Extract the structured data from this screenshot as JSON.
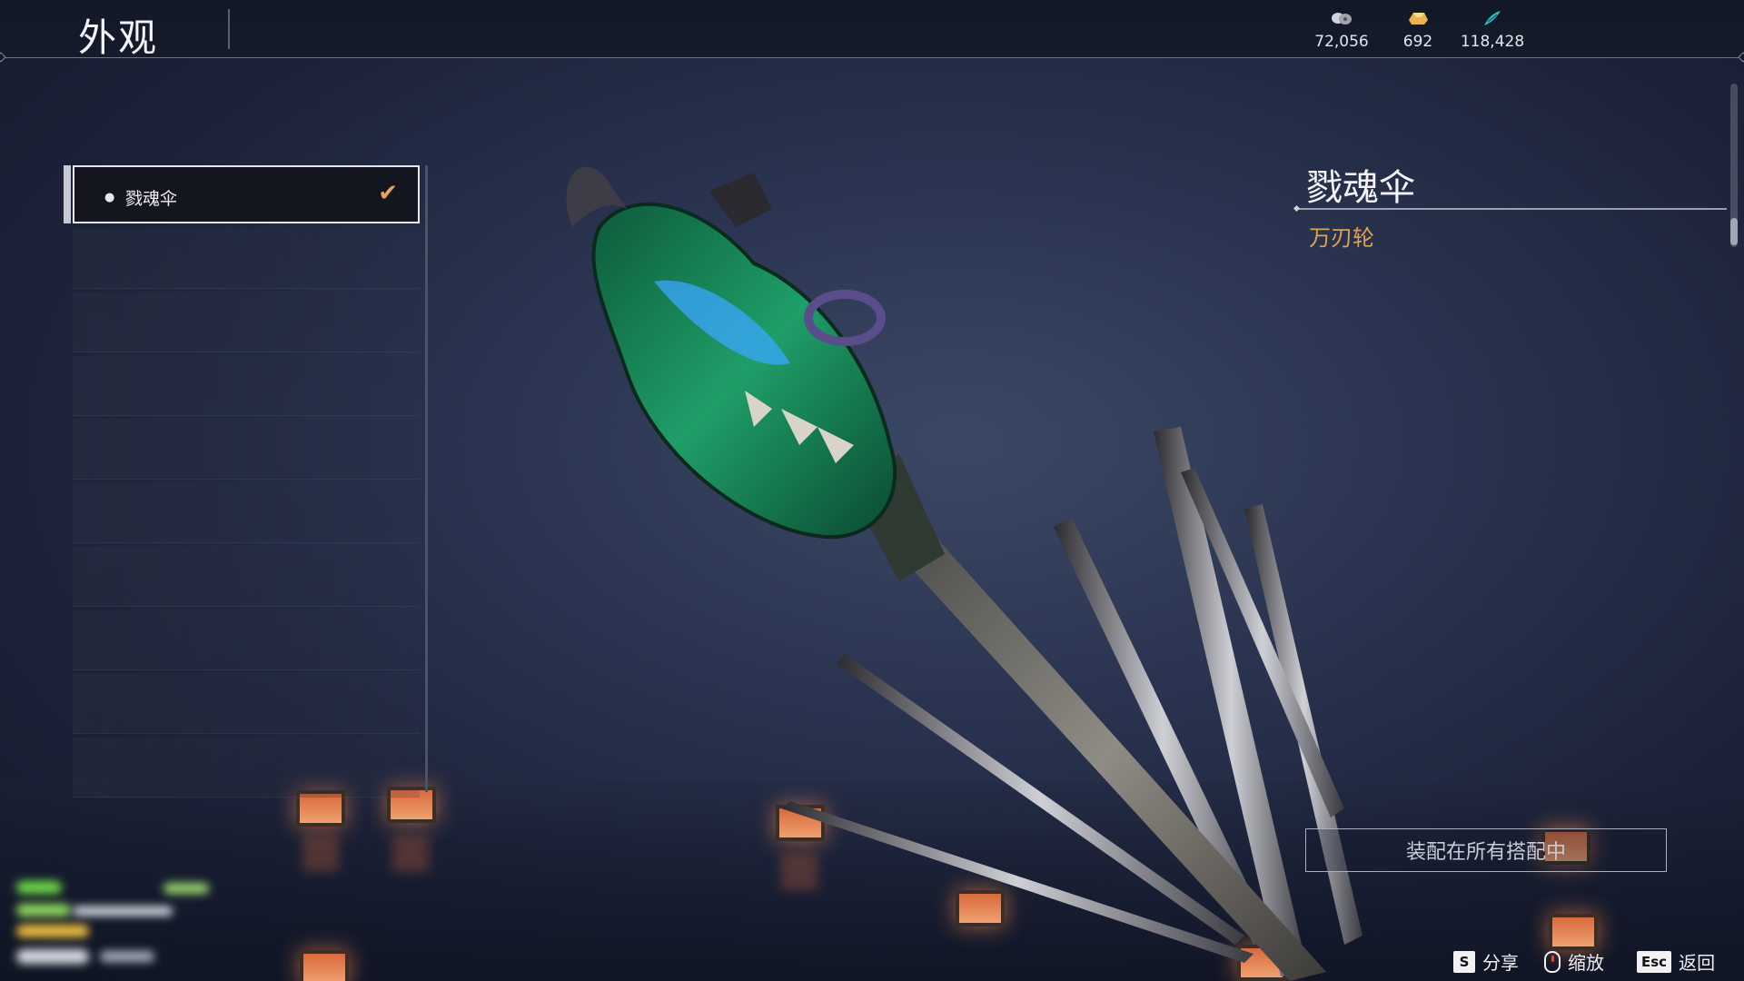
{
  "header": {
    "title": "外观"
  },
  "currencies": [
    {
      "icon": "coin-stack-icon",
      "value": "72,056"
    },
    {
      "icon": "gold-ingot-icon",
      "value": "692"
    },
    {
      "icon": "jade-feather-icon",
      "value": "118,428"
    }
  ],
  "skin_list": {
    "items": [
      {
        "label": "戮魂伞",
        "selected": true,
        "equipped": true
      }
    ]
  },
  "detail": {
    "name": "戮魂伞",
    "type": "万刃轮",
    "status": "装配在所有搭配中"
  },
  "footer": {
    "hints": [
      {
        "key": "S",
        "label": "分享"
      },
      {
        "key": "mouse-icon",
        "label": "缩放"
      },
      {
        "key": "Esc",
        "label": "返回"
      }
    ]
  },
  "colors": {
    "accent": "#e0a24e",
    "check": "#e6a35a",
    "background": "#2a3450"
  }
}
